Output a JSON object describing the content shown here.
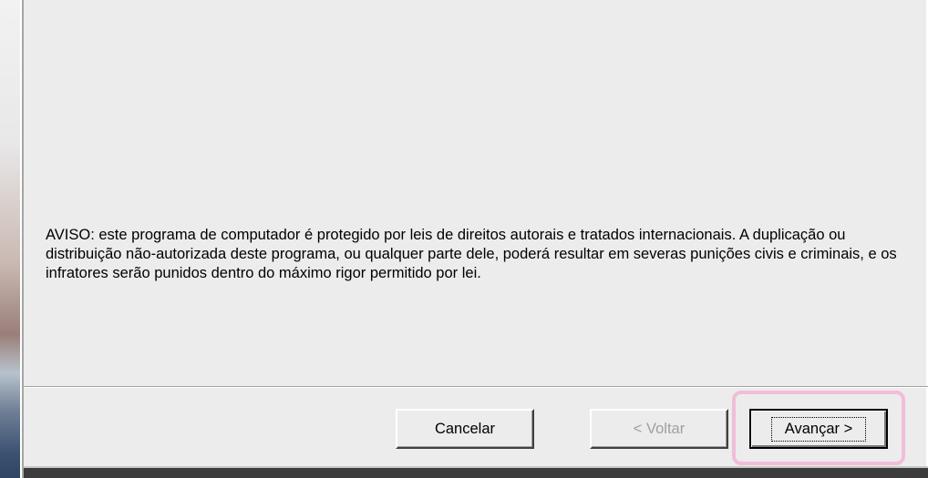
{
  "dialog": {
    "warning_text": "AVISO: este programa de computador é protegido por leis de direitos autorais e tratados internacionais. A duplicação ou distribuição não-autorizada deste programa, ou qualquer parte dele, poderá resultar em severas punições civis e criminais, e os infratores serão punidos dentro do máximo rigor permitido por lei."
  },
  "buttons": {
    "cancel_label": "Cancelar",
    "back_label": "< Voltar",
    "next_label": "Avançar >"
  },
  "colors": {
    "dialog_background": "#ececec",
    "highlight_outline": "#f1bdd8",
    "disabled_text": "#a0a0a0"
  }
}
